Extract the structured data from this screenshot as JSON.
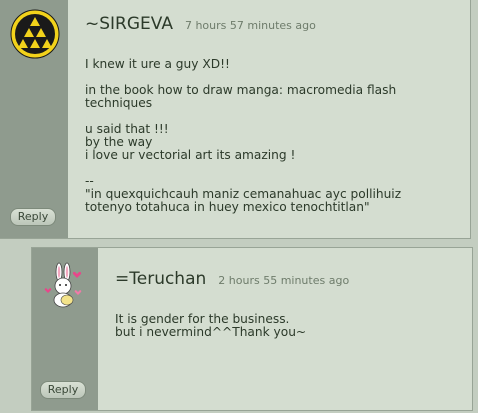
{
  "comments": [
    {
      "username": "~SIRGEVA",
      "timestamp": "7 hours 57 minutes ago",
      "text": "I knew it ure a guy XD!!\n\nin the book how to draw manga: macromedia flash techniques\n\nu said that !!!\nby the way\ni love ur vectorial art its amazing !\n\n--\n\"in quexquichcauh maniz cemanahuac ayc pollihuiz totenyo totahuca in huey mexico tenochtitlan\"",
      "reply_label": "Reply",
      "avatar_icon": "triforce-triangles-avatar-icon"
    },
    {
      "username": "=Teruchan",
      "timestamp": "2 hours 55 minutes ago",
      "text": "It is gender for the business.\nbut i nevermind^^Thank you~",
      "reply_label": "Reply",
      "avatar_icon": "bunny-with-hearts-avatar-icon"
    }
  ],
  "colors": {
    "page_bg": "#c3cdc0",
    "sidebar": "#8f9b8e",
    "comment_bg": "#d4ddd0",
    "text": "#2c3a2a",
    "timestamp": "#6e7c6b"
  }
}
